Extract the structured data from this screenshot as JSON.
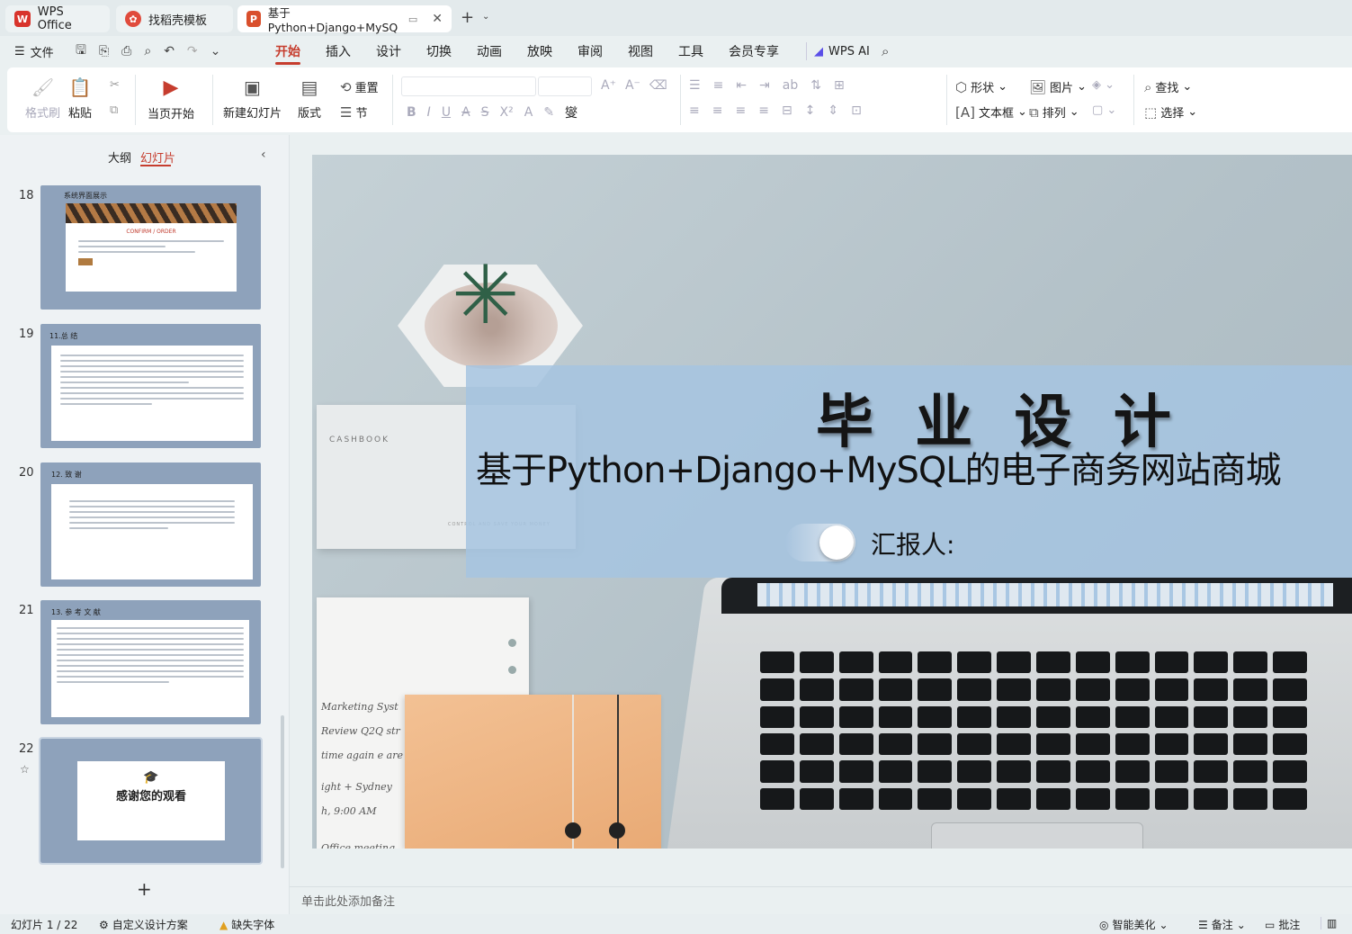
{
  "tabs": [
    {
      "label": "WPS Office"
    },
    {
      "label": "找稻壳模板"
    },
    {
      "label": "基于Python+Django+MySQ"
    }
  ],
  "menu": {
    "file": "文件",
    "tabs": [
      "开始",
      "插入",
      "设计",
      "切换",
      "动画",
      "放映",
      "审阅",
      "视图",
      "工具",
      "会员专享"
    ],
    "wps_ai": "WPS AI"
  },
  "ribbon": {
    "format_painter": "格式刷",
    "paste": "粘贴",
    "start_from_current": "当页开始",
    "new_slide": "新建幻灯片",
    "layout": "版式",
    "reset": "重置",
    "section": "节",
    "shape": "形状",
    "picture": "图片",
    "textbox": "文本框",
    "arrange": "排列",
    "find": "查找",
    "select": "选择"
  },
  "panel": {
    "outline": "大纲",
    "slides": "幻灯片"
  },
  "thumbnails": [
    {
      "num": "18",
      "title": "系统界面展示",
      "sub": "CONFIRM / ORDER"
    },
    {
      "num": "19",
      "title": "11.总 结"
    },
    {
      "num": "20",
      "title": "12. 致 谢"
    },
    {
      "num": "21",
      "title": "13. 参 考 文 献"
    },
    {
      "num": "22",
      "title": "感谢您的观看"
    }
  ],
  "slide": {
    "title": "毕 业 设 计",
    "subtitle": "基于Python+Django+MySQL的电子商务网站商城",
    "reporter": "汇报人:",
    "cashbook": "CASHBOOK",
    "notebook_text": "CONTROL AND SAVE YOUR MONEY",
    "handwriting": [
      "Marketing  Syst",
      "Review  Q2Q  str",
      "time  again  e  are",
      "ight  +  Sydney",
      "h,  9:00 AM",
      "Office  meeting"
    ]
  },
  "notes_placeholder": "单击此处添加备注",
  "status": {
    "slide_count": "幻灯片 1 / 22",
    "custom_design": "自定义设计方案",
    "missing_font": "缺失字体",
    "beautify": "智能美化",
    "notes": "备注",
    "comments": "批注"
  },
  "colors": {
    "accent": "#c63d2e",
    "thumb_bg": "#8ea2bb",
    "banner": "#a7c3de"
  }
}
